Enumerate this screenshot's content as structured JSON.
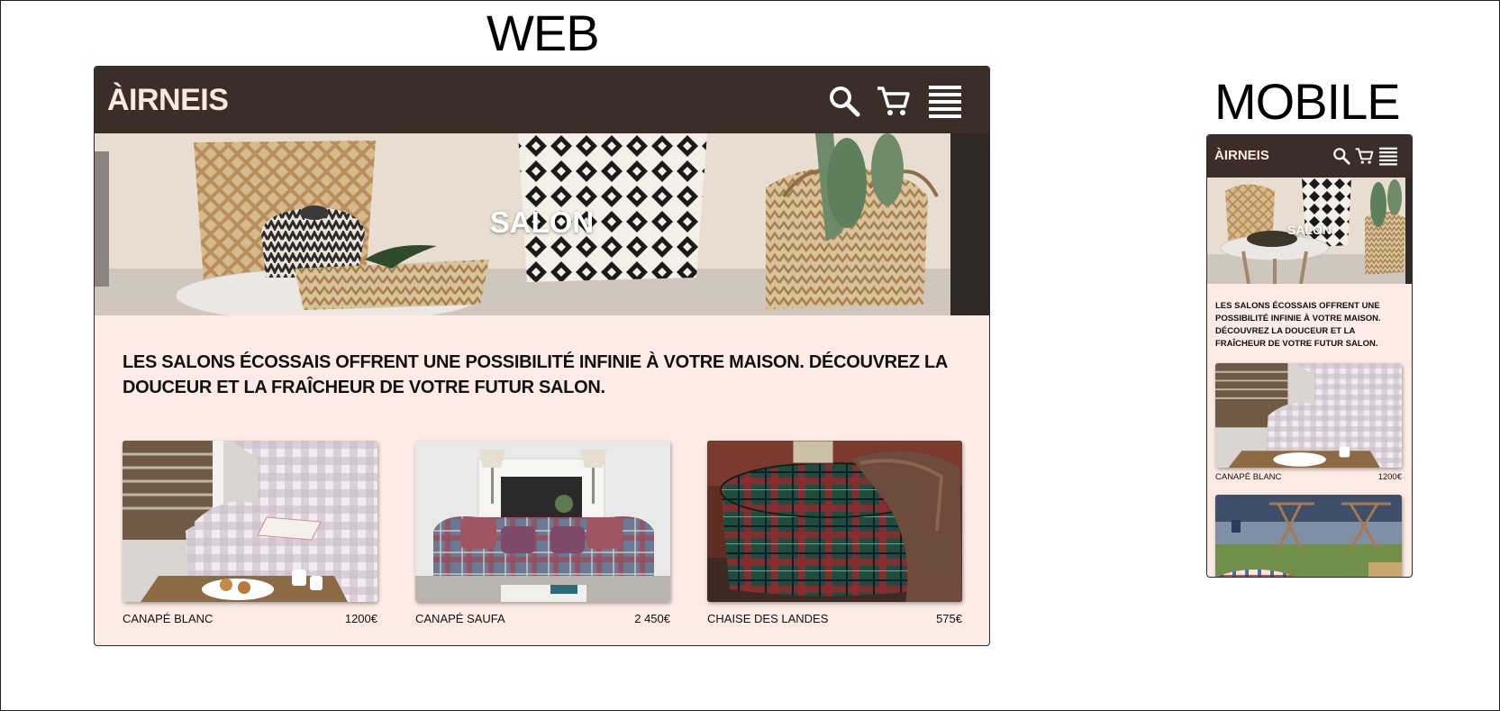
{
  "labels": {
    "web": "WEB",
    "mobile": "MOBILE"
  },
  "web": {
    "logo": "ÀIRNEIS",
    "hero_title": "SALON",
    "intro": "LES SALONS ÉCOSSAIS OFFRENT UNE POSSIBILITÉ INFINIE À VOTRE MAISON. DÉCOUVREZ LA DOUCEUR ET LA FRAÎCHEUR DE VOTRE FUTUR SALON.",
    "products": [
      {
        "name": "CANAPÉ BLANC",
        "price": "1200€"
      },
      {
        "name": "CANAPÉ SAUFA",
        "price": "2 450€"
      },
      {
        "name": "CHAISE DES LANDES",
        "price": "575€"
      }
    ]
  },
  "mobile": {
    "logo": "ÀIRNEIS",
    "hero_title": "SALON",
    "intro": "LES SALONS ÉCOSSAIS OFFRENT UNE POSSIBILITÉ INFINIE À VOTRE MAISON. DÉCOUVREZ LA DOUCEUR ET LA FRAÎCHEUR DE VOTRE FUTUR SALON.",
    "products": [
      {
        "name": "CANAPÉ BLANC",
        "price": "1200€"
      }
    ]
  },
  "icons": [
    "search-icon",
    "cart-icon",
    "hamburger-menu-icon"
  ],
  "colors": {
    "navbar": "#3b2d27",
    "logo": "#fbe8e0",
    "page_background": "#fdece5",
    "text": "#111111"
  }
}
